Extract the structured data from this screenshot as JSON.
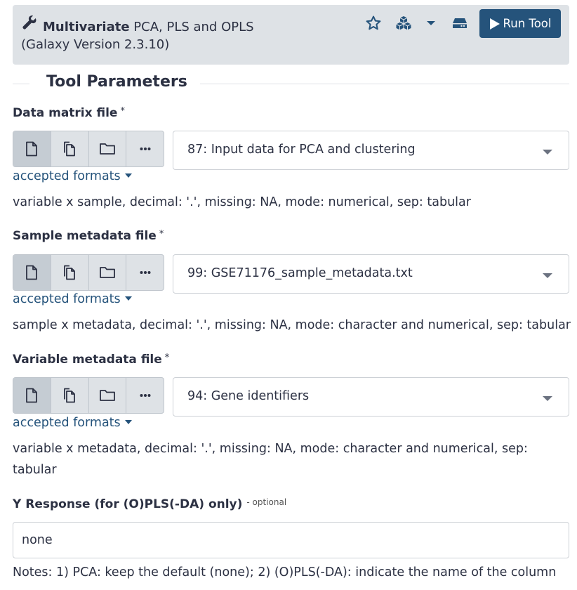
{
  "header": {
    "title_bold": "Multivariate",
    "title_rest": " PCA, PLS and OPLS",
    "version": "(Galaxy Version 2.3.10)",
    "run_label": "Run Tool",
    "accent": "#25537b",
    "icons": [
      "wrench-icon",
      "star-icon",
      "cubes-icon",
      "caret-down-icon",
      "hdd-icon",
      "play-icon"
    ]
  },
  "section_title": "Tool Parameters",
  "params": [
    {
      "label": "Data matrix file",
      "required": "*",
      "value": "87: Input data for PCA and clustering",
      "formats_label": "accepted formats",
      "help": "variable x sample, decimal: '.', missing: NA, mode: numerical, sep: tabular"
    },
    {
      "label": "Sample metadata file",
      "required": "*",
      "value": "99: GSE71176_sample_metadata.txt",
      "formats_label": "accepted formats",
      "help": "sample x metadata, decimal: '.', missing: NA, mode: character and numerical, sep: tabular"
    },
    {
      "label": "Variable metadata file",
      "required": "*",
      "value": "94: Gene identifiers",
      "formats_label": "accepted formats",
      "help": "variable x metadata, decimal: '.', missing: NA, mode: character and numerical, sep: tabular"
    }
  ],
  "y_response": {
    "label": "Y Response (for (O)PLS(-DA) only)",
    "optional": "- optional",
    "value": "none",
    "help": "Notes: 1) PCA: keep the default (none); 2) (O)PLS(-DA): indicate the name of the column"
  }
}
